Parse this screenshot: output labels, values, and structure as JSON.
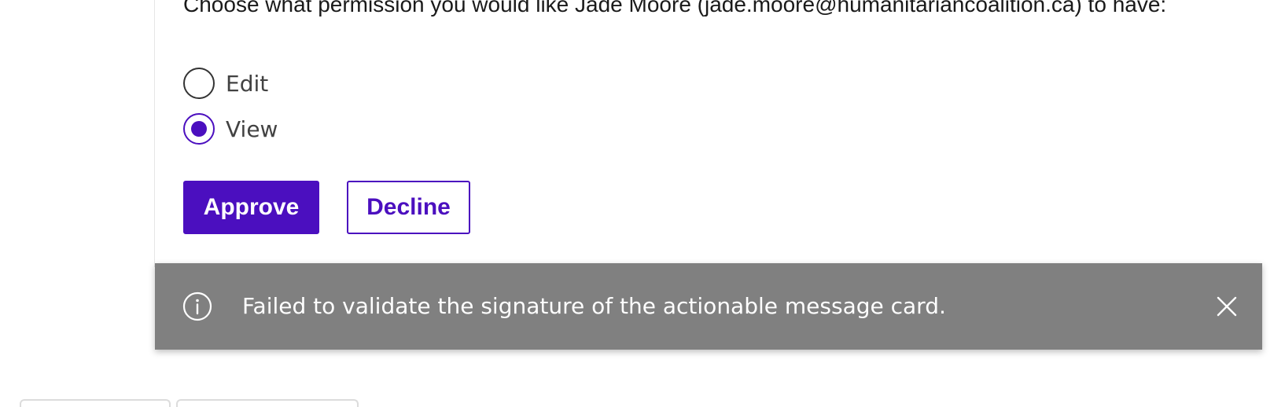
{
  "card": {
    "prompt": "Choose what permission you would like Jade Moore (jade.moore@humanitariancoalition.ca) to have:",
    "options": [
      {
        "label": "Edit",
        "selected": false
      },
      {
        "label": "View",
        "selected": true
      }
    ],
    "approve_label": "Approve",
    "decline_label": "Decline"
  },
  "toast": {
    "message": "Failed to validate the signature of the actionable message card.",
    "info_icon": "info-icon",
    "close_icon": "close-icon"
  },
  "colors": {
    "accent": "#4b0fbf",
    "toast_bg": "#808080",
    "text": "#1a1a1a"
  }
}
